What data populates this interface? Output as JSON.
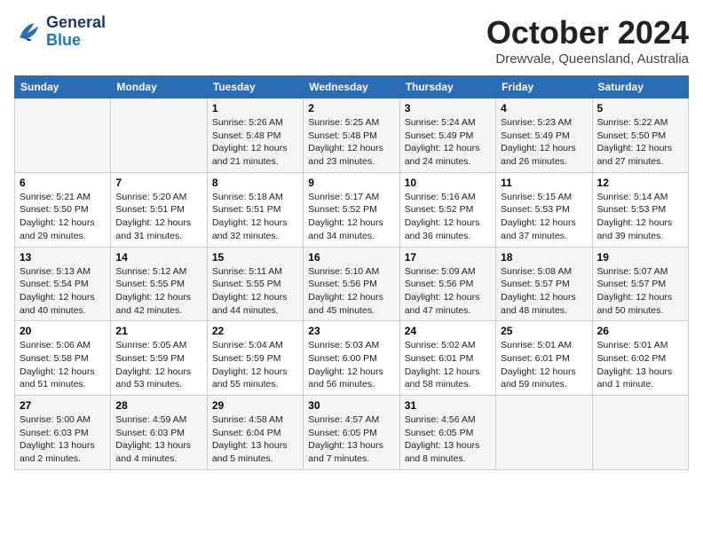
{
  "header": {
    "logo_line1": "General",
    "logo_line2": "Blue",
    "month": "October 2024",
    "location": "Drewvale, Queensland, Australia"
  },
  "weekdays": [
    "Sunday",
    "Monday",
    "Tuesday",
    "Wednesday",
    "Thursday",
    "Friday",
    "Saturday"
  ],
  "weeks": [
    [
      {
        "day": "",
        "info": ""
      },
      {
        "day": "",
        "info": ""
      },
      {
        "day": "1",
        "info": "Sunrise: 5:26 AM\nSunset: 5:48 PM\nDaylight: 12 hours and 21 minutes."
      },
      {
        "day": "2",
        "info": "Sunrise: 5:25 AM\nSunset: 5:48 PM\nDaylight: 12 hours and 23 minutes."
      },
      {
        "day": "3",
        "info": "Sunrise: 5:24 AM\nSunset: 5:49 PM\nDaylight: 12 hours and 24 minutes."
      },
      {
        "day": "4",
        "info": "Sunrise: 5:23 AM\nSunset: 5:49 PM\nDaylight: 12 hours and 26 minutes."
      },
      {
        "day": "5",
        "info": "Sunrise: 5:22 AM\nSunset: 5:50 PM\nDaylight: 12 hours and 27 minutes."
      }
    ],
    [
      {
        "day": "6",
        "info": "Sunrise: 5:21 AM\nSunset: 5:50 PM\nDaylight: 12 hours and 29 minutes."
      },
      {
        "day": "7",
        "info": "Sunrise: 5:20 AM\nSunset: 5:51 PM\nDaylight: 12 hours and 31 minutes."
      },
      {
        "day": "8",
        "info": "Sunrise: 5:18 AM\nSunset: 5:51 PM\nDaylight: 12 hours and 32 minutes."
      },
      {
        "day": "9",
        "info": "Sunrise: 5:17 AM\nSunset: 5:52 PM\nDaylight: 12 hours and 34 minutes."
      },
      {
        "day": "10",
        "info": "Sunrise: 5:16 AM\nSunset: 5:52 PM\nDaylight: 12 hours and 36 minutes."
      },
      {
        "day": "11",
        "info": "Sunrise: 5:15 AM\nSunset: 5:53 PM\nDaylight: 12 hours and 37 minutes."
      },
      {
        "day": "12",
        "info": "Sunrise: 5:14 AM\nSunset: 5:53 PM\nDaylight: 12 hours and 39 minutes."
      }
    ],
    [
      {
        "day": "13",
        "info": "Sunrise: 5:13 AM\nSunset: 5:54 PM\nDaylight: 12 hours and 40 minutes."
      },
      {
        "day": "14",
        "info": "Sunrise: 5:12 AM\nSunset: 5:55 PM\nDaylight: 12 hours and 42 minutes."
      },
      {
        "day": "15",
        "info": "Sunrise: 5:11 AM\nSunset: 5:55 PM\nDaylight: 12 hours and 44 minutes."
      },
      {
        "day": "16",
        "info": "Sunrise: 5:10 AM\nSunset: 5:56 PM\nDaylight: 12 hours and 45 minutes."
      },
      {
        "day": "17",
        "info": "Sunrise: 5:09 AM\nSunset: 5:56 PM\nDaylight: 12 hours and 47 minutes."
      },
      {
        "day": "18",
        "info": "Sunrise: 5:08 AM\nSunset: 5:57 PM\nDaylight: 12 hours and 48 minutes."
      },
      {
        "day": "19",
        "info": "Sunrise: 5:07 AM\nSunset: 5:57 PM\nDaylight: 12 hours and 50 minutes."
      }
    ],
    [
      {
        "day": "20",
        "info": "Sunrise: 5:06 AM\nSunset: 5:58 PM\nDaylight: 12 hours and 51 minutes."
      },
      {
        "day": "21",
        "info": "Sunrise: 5:05 AM\nSunset: 5:59 PM\nDaylight: 12 hours and 53 minutes."
      },
      {
        "day": "22",
        "info": "Sunrise: 5:04 AM\nSunset: 5:59 PM\nDaylight: 12 hours and 55 minutes."
      },
      {
        "day": "23",
        "info": "Sunrise: 5:03 AM\nSunset: 6:00 PM\nDaylight: 12 hours and 56 minutes."
      },
      {
        "day": "24",
        "info": "Sunrise: 5:02 AM\nSunset: 6:01 PM\nDaylight: 12 hours and 58 minutes."
      },
      {
        "day": "25",
        "info": "Sunrise: 5:01 AM\nSunset: 6:01 PM\nDaylight: 12 hours and 59 minutes."
      },
      {
        "day": "26",
        "info": "Sunrise: 5:01 AM\nSunset: 6:02 PM\nDaylight: 13 hours and 1 minute."
      }
    ],
    [
      {
        "day": "27",
        "info": "Sunrise: 5:00 AM\nSunset: 6:03 PM\nDaylight: 13 hours and 2 minutes."
      },
      {
        "day": "28",
        "info": "Sunrise: 4:59 AM\nSunset: 6:03 PM\nDaylight: 13 hours and 4 minutes."
      },
      {
        "day": "29",
        "info": "Sunrise: 4:58 AM\nSunset: 6:04 PM\nDaylight: 13 hours and 5 minutes."
      },
      {
        "day": "30",
        "info": "Sunrise: 4:57 AM\nSunset: 6:05 PM\nDaylight: 13 hours and 7 minutes."
      },
      {
        "day": "31",
        "info": "Sunrise: 4:56 AM\nSunset: 6:05 PM\nDaylight: 13 hours and 8 minutes."
      },
      {
        "day": "",
        "info": ""
      },
      {
        "day": "",
        "info": ""
      }
    ]
  ]
}
